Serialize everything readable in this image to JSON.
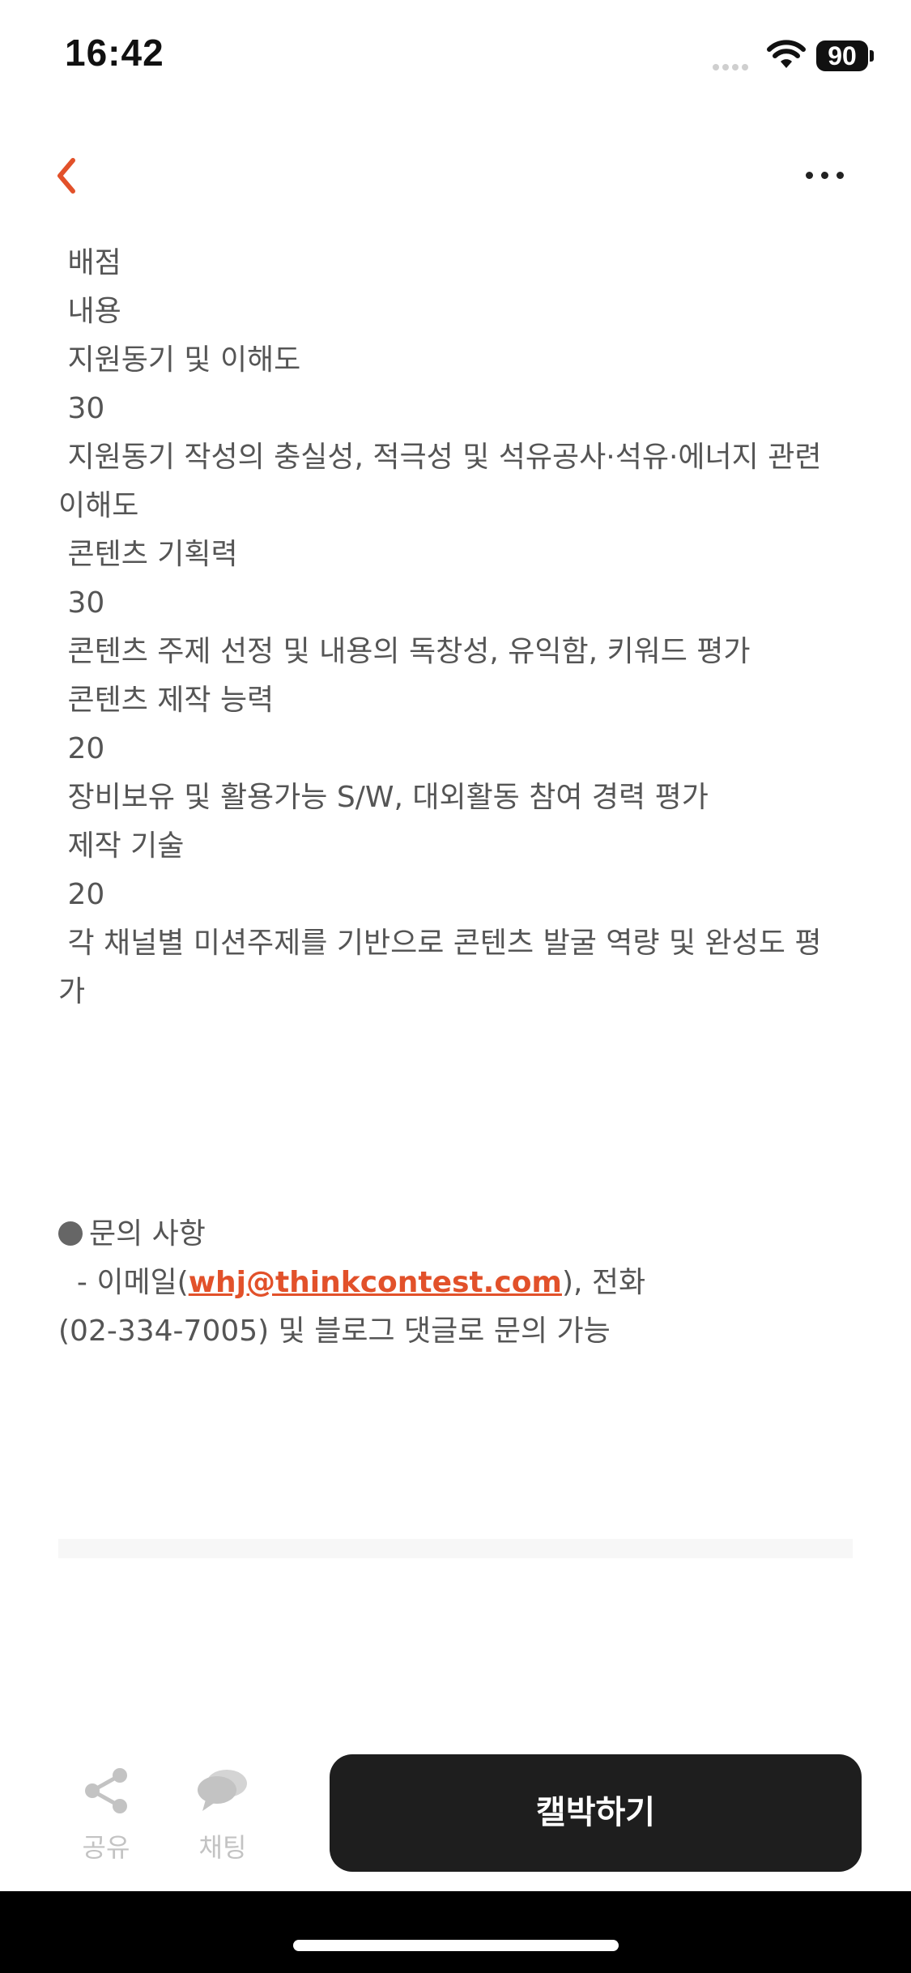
{
  "status_bar": {
    "time": "16:42",
    "battery": "90"
  },
  "content_lines": [
    " 배점",
    " 내용",
    " 지원동기 및 이해도",
    " 30",
    " 지원동기 작성의 충실성, 적극성 및 석유공사·석유·에너지 관련",
    "이해도",
    " 콘텐츠 기획력",
    " 30",
    " 콘텐츠 주제 선정 및 내용의 독창성, 유익함, 키워드 평가",
    " 콘텐츠 제작 능력",
    " 20",
    " 장비보유 및 활용가능 S/W, 대외활동 참여 경력 평가",
    " 제작 기술",
    " 20",
    " 각 채널별 미션주제를 기반으로 콘텐츠 발굴 역량 및 완성도 평",
    "가"
  ],
  "inquiry": {
    "title": "문의 사항",
    "email_prefix": "  - 이메일(",
    "email": "whj@thinkcontest.com",
    "email_suffix": "), 전화",
    "phone_line": "(02-334-7005) 및 블로그 댓글로 문의 가능"
  },
  "bottom_bar": {
    "share_label": "공유",
    "chat_label": "채팅",
    "scrap_label": "캘박하기"
  },
  "colors": {
    "accent": "#e2512a",
    "text": "#555555",
    "button": "#1e1e1e"
  },
  "icons": [
    "back-chevron-icon",
    "more-icon",
    "share-icon",
    "chat-icon",
    "wifi-icon",
    "battery-icon"
  ]
}
